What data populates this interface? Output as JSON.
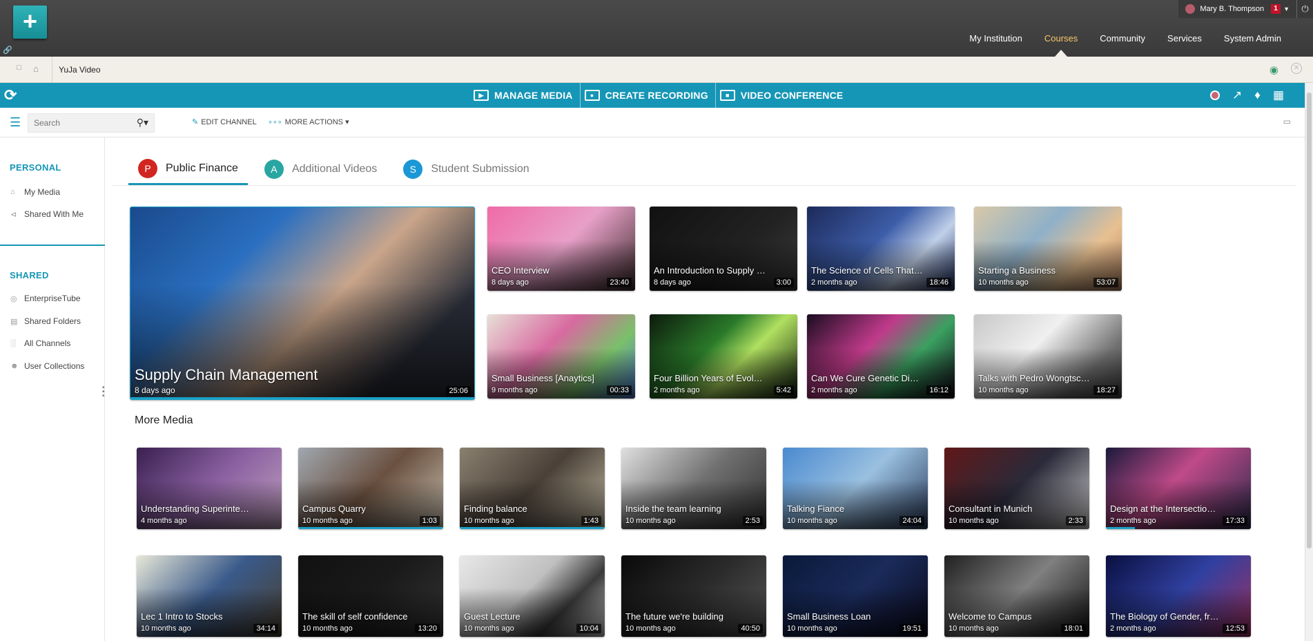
{
  "inst_header": {
    "user_name": "Mary B. Thompson",
    "notification_count": "1",
    "nav": [
      "My Institution",
      "Courses",
      "Community",
      "Services",
      "System Admin"
    ],
    "active_nav": "Courses"
  },
  "breadcrumb": {
    "title": "YuJa Video"
  },
  "app_bar": {
    "actions": [
      "MANAGE MEDIA",
      "CREATE RECORDING",
      "VIDEO CONFERENCE"
    ]
  },
  "toolbar": {
    "search_placeholder": "Search",
    "edit_channel": "EDIT CHANNEL",
    "more_actions": "MORE ACTIONS"
  },
  "sidebar": {
    "personal_heading": "PERSONAL",
    "personal_items": [
      "My Media",
      "Shared With Me"
    ],
    "shared_heading": "SHARED",
    "shared_items": [
      "EnterpriseTube",
      "Shared Folders",
      "All Channels",
      "User Collections"
    ]
  },
  "tabs": [
    {
      "badge": "P",
      "label": "Public Finance",
      "color": "#d0261f"
    },
    {
      "badge": "A",
      "label": "Additional Videos",
      "color": "#2aa6a2"
    },
    {
      "badge": "S",
      "label": "Student Submission",
      "color": "#1a97d6"
    }
  ],
  "featured": {
    "title": "Supply Chain Management",
    "date": "8 days ago",
    "duration": "25:06",
    "progress": 1.0
  },
  "channel_media": [
    {
      "title": "CEO Interview",
      "date": "8 days ago",
      "duration": "23:40"
    },
    {
      "title": "An Introduction to Supply & D...",
      "date": "8 days ago",
      "duration": "3:00"
    },
    {
      "title": "The Science of Cells That Never ...",
      "date": "2 months ago",
      "duration": "18:46"
    },
    {
      "title": "Starting a Business",
      "date": "10 months ago",
      "duration": "53:07"
    },
    {
      "title": "Small Business [Anaytics]",
      "date": "9 months ago",
      "duration": "00:33"
    },
    {
      "title": "Four Billion Years of Evolution in ...",
      "date": "2 months ago",
      "duration": "5:42"
    },
    {
      "title": "Can We Cure Genetic Diseases?",
      "date": "2 months ago",
      "duration": "16:12"
    },
    {
      "title": "Talks with Pedro Wongtschow...",
      "date": "10 months ago",
      "duration": "18:27"
    }
  ],
  "more_media_title": "More Media",
  "more_media": [
    {
      "title": "Understanding Superintellige...",
      "date": "4 months ago",
      "duration": "",
      "progress": 0
    },
    {
      "title": "Campus Quarry",
      "date": "10 months ago",
      "duration": "1:03",
      "progress": 1.0
    },
    {
      "title": "Finding balance",
      "date": "10 months ago",
      "duration": "1:43",
      "progress": 1.0
    },
    {
      "title": "Inside the team learning",
      "date": "10 months ago",
      "duration": "2:53",
      "progress": 0
    },
    {
      "title": "Talking Fiance",
      "date": "10 months ago",
      "duration": "24:04",
      "progress": 0
    },
    {
      "title": "Consultant in Munich",
      "date": "10 months ago",
      "duration": "2:33",
      "progress": 0
    },
    {
      "title": "Design at the Intersection of Tec...",
      "date": "2 months ago",
      "duration": "17:33",
      "progress": 0.2
    },
    {
      "title": "Lec 1 Intro to Stocks",
      "date": "10 months ago",
      "duration": "34:14",
      "progress": 0
    },
    {
      "title": "The skill of self confidence",
      "date": "10 months ago",
      "duration": "13:20",
      "progress": 0
    },
    {
      "title": "Guest Lecture",
      "date": "10 months ago",
      "duration": "10:04",
      "progress": 0
    },
    {
      "title": "The future we're building",
      "date": "10 months ago",
      "duration": "40:50",
      "progress": 0
    },
    {
      "title": "Small Business Loan",
      "date": "10 months ago",
      "duration": "19:51",
      "progress": 0
    },
    {
      "title": "Welcome to Campus",
      "date": "10 months ago",
      "duration": "18:01",
      "progress": 0
    },
    {
      "title": "The Biology of Gender, from DN...",
      "date": "2 months ago",
      "duration": "12:53",
      "progress": 0
    }
  ]
}
